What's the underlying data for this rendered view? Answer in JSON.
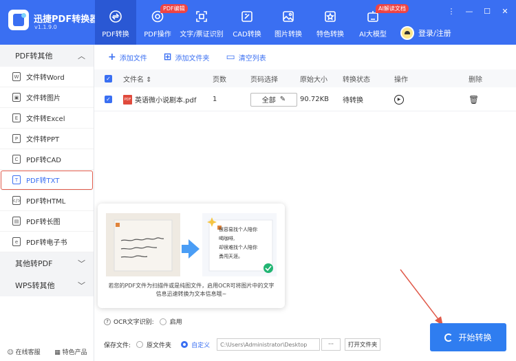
{
  "app": {
    "name": "迅捷PDF转换器",
    "version": "v1.1.9.0"
  },
  "nav": [
    {
      "label": "PDF转换",
      "icon": "convert-icon",
      "active": true
    },
    {
      "label": "PDF操作",
      "icon": "settings-icon",
      "badge": "PDF编辑"
    },
    {
      "label": "文字/票证识别",
      "icon": "scan-icon"
    },
    {
      "label": "CAD转换",
      "icon": "cad-icon"
    },
    {
      "label": "图片转换",
      "icon": "image-icon"
    },
    {
      "label": "特色转换",
      "icon": "star-icon"
    },
    {
      "label": "AI大模型",
      "icon": "ai-icon",
      "badge": "AI解读文档"
    }
  ],
  "login": {
    "label": "登录/注册"
  },
  "sidebar": {
    "sections": [
      {
        "label": "PDF转其他"
      },
      {
        "label": "其他转PDF"
      },
      {
        "label": "WPS转其他"
      }
    ],
    "items": [
      {
        "label": "文件转Word",
        "icon": "W"
      },
      {
        "label": "文件转图片",
        "icon": "▣"
      },
      {
        "label": "文件转Excel",
        "icon": "E"
      },
      {
        "label": "文件转PPT",
        "icon": "P"
      },
      {
        "label": "PDF转CAD",
        "icon": "C"
      },
      {
        "label": "PDF转TXT",
        "icon": "T"
      },
      {
        "label": "PDF转HTML",
        "icon": "</>"
      },
      {
        "label": "PDF转长图",
        "icon": "▤"
      },
      {
        "label": "PDF转电子书",
        "icon": "e"
      }
    ],
    "footer": {
      "service": "在线客服",
      "featured": "特色产品"
    }
  },
  "toolbar": {
    "add_file": "添加文件",
    "add_folder": "添加文件夹",
    "clear": "清空列表"
  },
  "table": {
    "headers": [
      "文件名",
      "页数",
      "页码选择",
      "原始大小",
      "转换状态",
      "操作",
      "删除"
    ],
    "rows": [
      {
        "name": "英语微小说剧本.pdf",
        "pages": "1",
        "page_select": "全部",
        "size": "90.72KB",
        "status": "待转换"
      }
    ]
  },
  "ocr_card": {
    "bubble": [
      "很容易找个人陪你",
      "喝咖啡,",
      "却很难找个人陪你",
      "勇闯天涯。"
    ],
    "desc": "若您的PDF文件为扫描件或是纯图文件，启用OCR可将图片中的文字信息迅速转换为文本信息哦~"
  },
  "options": {
    "ocr_label": "OCR文字识别:",
    "ocr_enable": "启用",
    "save_label": "保存文件:",
    "save_orig": "原文件夹",
    "save_custom": "自定义",
    "path": "C:\\Users\\Administrator\\Desktop",
    "more": "···",
    "open_folder": "打开文件夹"
  },
  "start_button": "开始转换",
  "colors": {
    "brand": "#3a6ff2",
    "highlight": "#e05a4a",
    "start": "#2f7df0"
  }
}
